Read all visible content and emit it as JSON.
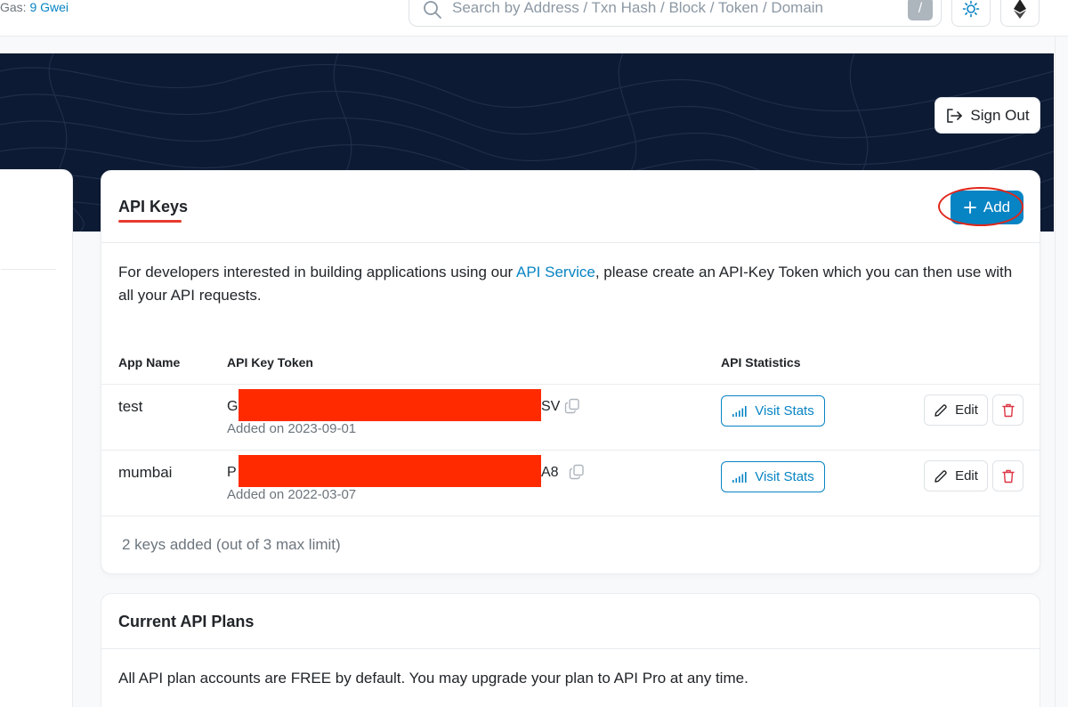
{
  "topbar": {
    "gas_label": "Gas:",
    "gas_value": "9 Gwei",
    "search_placeholder": "Search by Address / Txn Hash / Block / Token / Domain",
    "search_shortcut": "/"
  },
  "hero": {
    "sign_out_label": "Sign Out"
  },
  "api_keys": {
    "title": "API Keys",
    "add_label": "Add",
    "description_before": "For developers interested in building applications using our ",
    "description_link": "API Service",
    "description_after": ", please create an API-Key Token which you can then use with all your API requests.",
    "columns": [
      "App Name",
      "API Key Token",
      "API Statistics"
    ],
    "rows": [
      {
        "app_name": "test",
        "token_prefix": "G",
        "token_suffix": "SV",
        "added": "Added on 2023-09-01",
        "stats_label": "Visit Stats",
        "edit_label": "Edit"
      },
      {
        "app_name": "mumbai",
        "token_prefix": "P",
        "token_suffix": "A8",
        "added": "Added on 2022-03-07",
        "stats_label": "Visit Stats",
        "edit_label": "Edit"
      }
    ],
    "footer": "2 keys added (out of 3 max limit)"
  },
  "plans": {
    "title": "Current API Plans",
    "text": "All API plan accounts are FREE by default. You may upgrade your plan to API Pro at any time."
  },
  "colors": {
    "accent": "#0784c3",
    "hero_bg": "#0d1a33",
    "redaction": "#ff2a00",
    "delete": "#dc3545",
    "annotation": "#e0261b"
  }
}
